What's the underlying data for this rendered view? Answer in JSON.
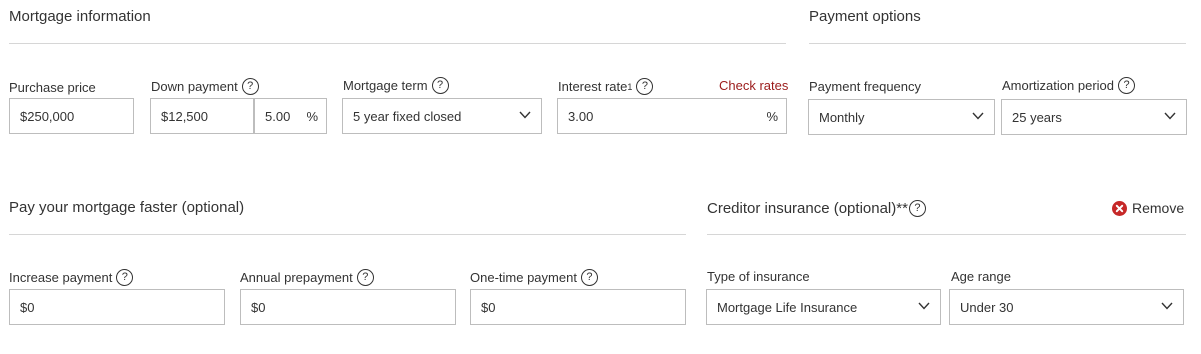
{
  "mortgage": {
    "title": "Mortgage information",
    "purchase_price": {
      "label": "Purchase price",
      "value": "$250,000"
    },
    "down_payment": {
      "label": "Down payment",
      "value": "$12,500",
      "percent_value": "5.00",
      "percent_unit": "%"
    },
    "term": {
      "label": "Mortgage term",
      "selected": "5 year fixed closed"
    },
    "interest_rate": {
      "label": "Interest rate",
      "footnote": "1",
      "value": "3.00",
      "unit": "%",
      "link": "Check rates"
    }
  },
  "payment_options": {
    "title": "Payment options",
    "frequency": {
      "label": "Payment frequency",
      "selected": "Monthly"
    },
    "amortization": {
      "label": "Amortization period",
      "selected": "25 years"
    }
  },
  "faster": {
    "title": "Pay your mortgage faster (optional)",
    "increase": {
      "label": "Increase payment",
      "value": "$0"
    },
    "annual": {
      "label": "Annual prepayment",
      "value": "$0"
    },
    "one_time": {
      "label": "One-time payment",
      "value": "$0"
    }
  },
  "insurance": {
    "title": "Creditor insurance (optional)",
    "title_suffix": "**",
    "remove": "Remove",
    "type": {
      "label": "Type of insurance",
      "selected": "Mortgage Life Insurance"
    },
    "age": {
      "label": "Age range",
      "selected": "Under 30"
    }
  },
  "help_glyph": "?",
  "icons": {
    "help": "help-circle-icon",
    "chevron": "chevron-down-icon",
    "remove": "x-circle-icon"
  },
  "colors": {
    "link": "#9b1b1b",
    "remove_icon": "#c62828",
    "border": "#bdbdbd",
    "rule": "#d6d6d6"
  }
}
